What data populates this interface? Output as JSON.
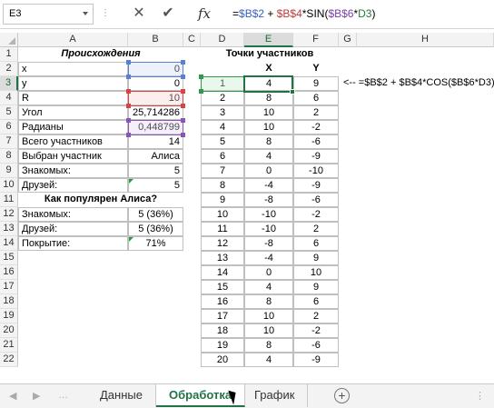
{
  "formula_bar": {
    "name_box": "E3",
    "fx": "fx",
    "formula_parts": [
      {
        "text": "=",
        "color": "plain"
      },
      {
        "text": "$B$2",
        "color": "blue"
      },
      {
        "text": " + ",
        "color": "plain"
      },
      {
        "text": "$B$4",
        "color": "red"
      },
      {
        "text": "*SIN(",
        "color": "plain"
      },
      {
        "text": "$B$6",
        "color": "purple"
      },
      {
        "text": "*",
        "color": "plain"
      },
      {
        "text": "D3",
        "color": "green"
      },
      {
        "text": ")",
        "color": "plain"
      }
    ]
  },
  "columns": [
    "A",
    "B",
    "C",
    "D",
    "E",
    "F",
    "G",
    "H"
  ],
  "rows": [
    "1",
    "2",
    "3",
    "4",
    "5",
    "6",
    "7",
    "8",
    "9",
    "10",
    "11",
    "12",
    "13",
    "14",
    "15",
    "16",
    "17",
    "18",
    "19",
    "20",
    "21",
    "22"
  ],
  "left_table": {
    "title": "Происхождения",
    "rows": [
      {
        "label": "x",
        "value": "0"
      },
      {
        "label": "y",
        "value": "0"
      },
      {
        "label": "R",
        "value": "10"
      },
      {
        "label": "Угол",
        "value": "25,714286"
      },
      {
        "label": "Радианы",
        "value": "0,448799"
      },
      {
        "label": "Всего участников",
        "value": "14"
      },
      {
        "label": "Выбран участник",
        "value": "Алиса"
      },
      {
        "label": "Знакомых:",
        "value": "5"
      },
      {
        "label": "Друзей:",
        "value": "5"
      }
    ],
    "popularity_title": "Как популярен Алиса?",
    "popularity_rows": [
      {
        "label": "Знакомых:",
        "value": "5 (36%)"
      },
      {
        "label": "Друзей:",
        "value": "5 (36%)"
      },
      {
        "label": "Покрытие:",
        "value": "71%"
      }
    ]
  },
  "points_table": {
    "title": "Точки участников",
    "header_x": "X",
    "header_y": "Y",
    "rows": [
      {
        "n": "1",
        "x": "4",
        "y": "9"
      },
      {
        "n": "2",
        "x": "8",
        "y": "6"
      },
      {
        "n": "3",
        "x": "10",
        "y": "2"
      },
      {
        "n": "4",
        "x": "10",
        "y": "-2"
      },
      {
        "n": "5",
        "x": "8",
        "y": "-6"
      },
      {
        "n": "6",
        "x": "4",
        "y": "-9"
      },
      {
        "n": "7",
        "x": "0",
        "y": "-10"
      },
      {
        "n": "8",
        "x": "-4",
        "y": "-9"
      },
      {
        "n": "9",
        "x": "-8",
        "y": "-6"
      },
      {
        "n": "10",
        "x": "-10",
        "y": "-2"
      },
      {
        "n": "11",
        "x": "-10",
        "y": "2"
      },
      {
        "n": "12",
        "x": "-8",
        "y": "6"
      },
      {
        "n": "13",
        "x": "-4",
        "y": "9"
      },
      {
        "n": "14",
        "x": "0",
        "y": "10"
      },
      {
        "n": "15",
        "x": "4",
        "y": "9"
      },
      {
        "n": "16",
        "x": "8",
        "y": "6"
      },
      {
        "n": "17",
        "x": "10",
        "y": "2"
      },
      {
        "n": "18",
        "x": "10",
        "y": "-2"
      },
      {
        "n": "19",
        "x": "8",
        "y": "-6"
      },
      {
        "n": "20",
        "x": "4",
        "y": "-9"
      }
    ]
  },
  "note": "<--  =$B$2 + $B$4*COS($B$6*D3)",
  "tabs": [
    "Данные",
    "Обработка",
    "График"
  ],
  "active_tab": "Обработка",
  "colors": {
    "accent": "#217346",
    "ref_blue": "#3a62c4",
    "ref_red": "#c2383a",
    "ref_purple": "#7a3fa6",
    "ref_green": "#1f7a3a"
  }
}
